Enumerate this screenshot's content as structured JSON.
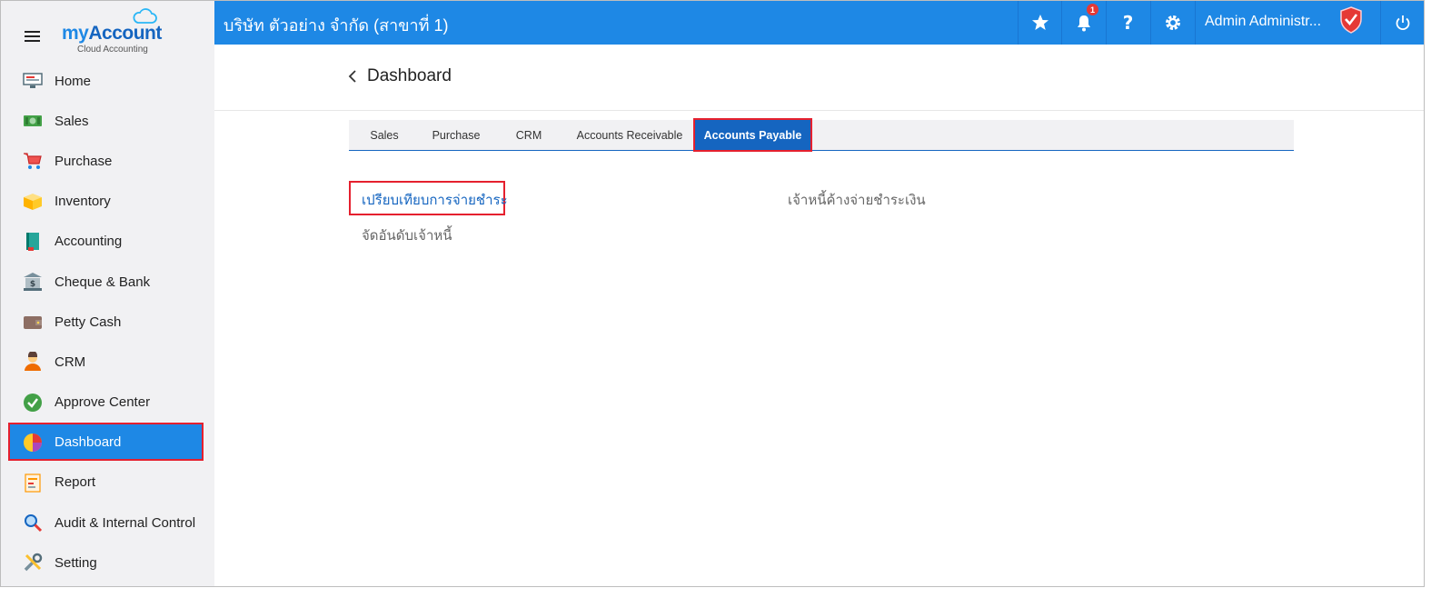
{
  "brand": {
    "title_my": "my",
    "title_account": "Account",
    "subtitle": "Cloud Accounting"
  },
  "topbar": {
    "company": "บริษัท ตัวอย่าง จำกัด (สาขาที่ 1)",
    "notification_count": "1",
    "help_label": "?",
    "user_name": "Admin Administr..."
  },
  "sidebar": {
    "items": [
      {
        "label": "Home",
        "icon": "home-monitor-icon"
      },
      {
        "label": "Sales",
        "icon": "cash-icon"
      },
      {
        "label": "Purchase",
        "icon": "cart-icon"
      },
      {
        "label": "Inventory",
        "icon": "box-icon"
      },
      {
        "label": "Accounting",
        "icon": "ledger-book-icon"
      },
      {
        "label": "Cheque & Bank",
        "icon": "bank-icon"
      },
      {
        "label": "Petty Cash",
        "icon": "wallet-icon"
      },
      {
        "label": "CRM",
        "icon": "customer-icon"
      },
      {
        "label": "Approve Center",
        "icon": "check-circle-icon"
      },
      {
        "label": "Dashboard",
        "icon": "pie-chart-icon"
      },
      {
        "label": "Report",
        "icon": "report-icon"
      },
      {
        "label": "Audit & Internal Control",
        "icon": "magnifier-icon"
      },
      {
        "label": "Setting",
        "icon": "tools-icon"
      }
    ],
    "active_index": 9
  },
  "page": {
    "title": "Dashboard"
  },
  "tabs": [
    {
      "label": "Sales"
    },
    {
      "label": "Purchase"
    },
    {
      "label": "CRM"
    },
    {
      "label": "Accounts Receivable"
    },
    {
      "label": "Accounts Payable"
    }
  ],
  "active_tab": "Accounts Payable",
  "reports": {
    "compare_payments": "เปรียบเทียบการจ่ายชำระ",
    "creditor_ranking": "จัดอันดับเจ้าหนี้",
    "outstanding_payables": "เจ้าหนี้ค้างจ่ายชำระเงิน"
  },
  "colors": {
    "primary": "#1e88e5",
    "tab_active": "#1565c0",
    "highlight": "#e5202e",
    "sidebar_bg": "#f1f1f3"
  }
}
